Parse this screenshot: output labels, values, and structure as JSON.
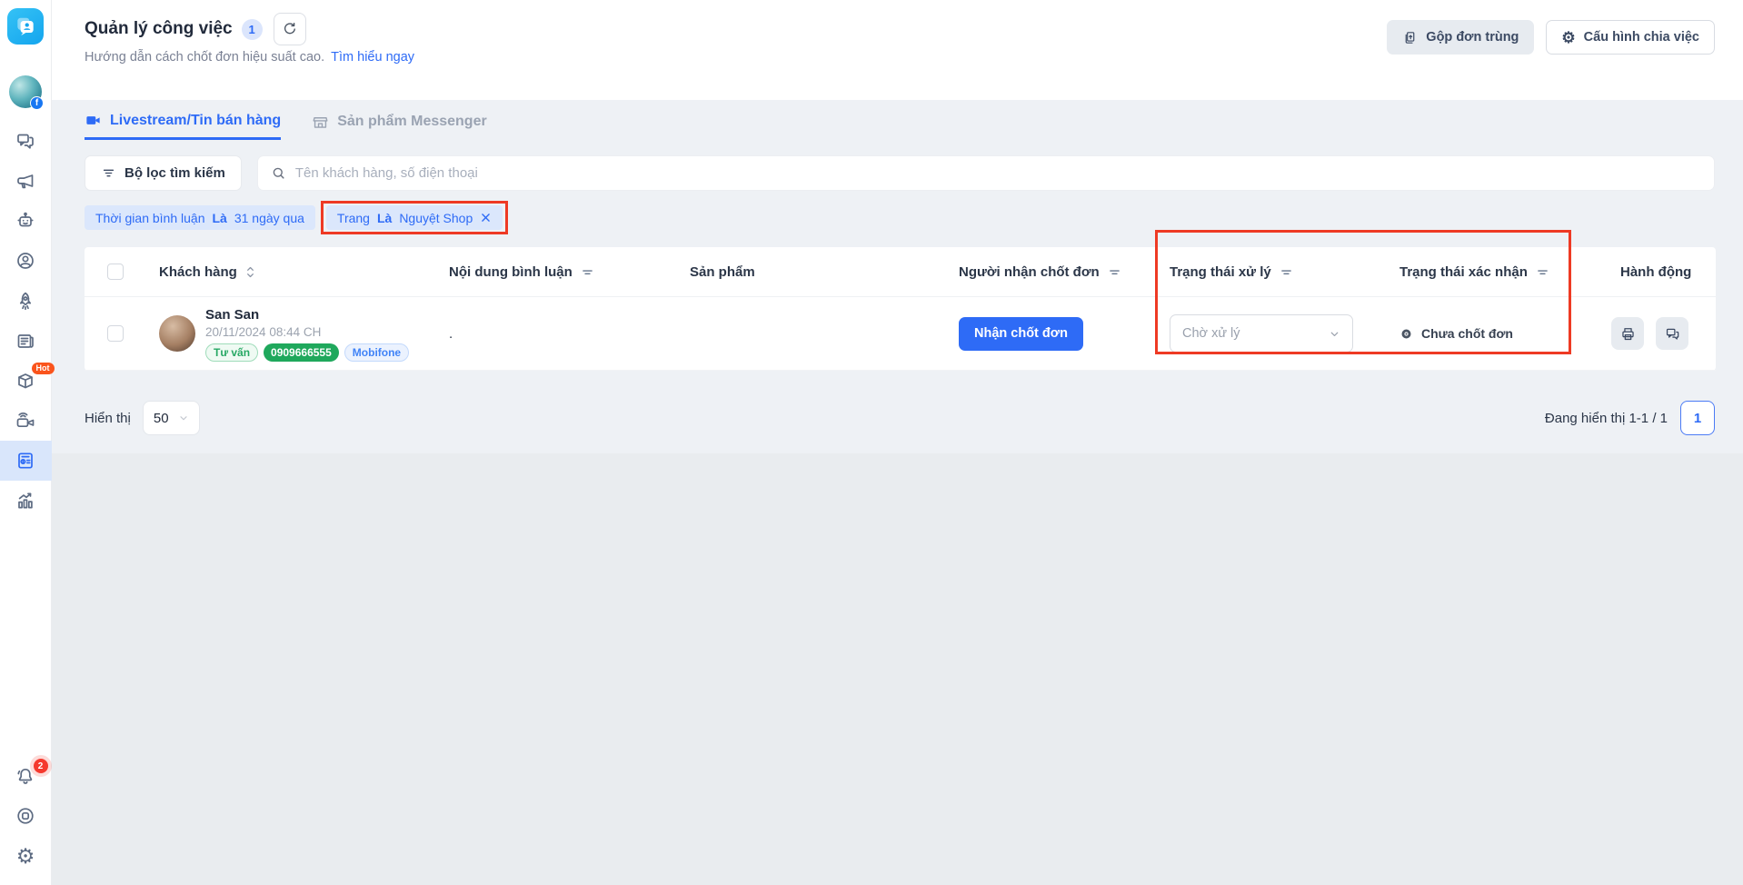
{
  "colors": {
    "accent": "#2e6bf6",
    "annotation_red": "#ee3a24",
    "green_solid": "#1fa85c",
    "sidebar_active_bg": "#d9e6fb"
  },
  "sidebar": {
    "hot_badge": "Hot",
    "notification_count": "2"
  },
  "header": {
    "title": "Quản lý công việc",
    "count_badge": "1",
    "subtitle": "Hướng dẫn cách chốt đơn hiệu suất cao.",
    "subtitle_link": "Tìm hiểu ngay",
    "merge_button": "Gộp đơn trùng",
    "config_button": "Cấu hình chia việc"
  },
  "tabs": {
    "livestream": "Livestream/Tin bán hàng",
    "messenger": "Sản phẩm Messenger"
  },
  "filter_bar": {
    "filter_button": "Bộ lọc tìm kiếm",
    "search_placeholder": "Tên khách hàng, số điện thoại"
  },
  "chips": {
    "time": {
      "prefix": "Thời gian bình luận",
      "operator": "Là",
      "value": "31 ngày qua"
    },
    "page": {
      "prefix": "Trang",
      "operator": "Là",
      "value": "Nguyệt Shop"
    }
  },
  "table": {
    "columns": [
      "Khách hàng",
      "Nội dung bình luận",
      "Sản phẩm",
      "Người nhận chốt đơn",
      "Trạng thái xử lý",
      "Trạng thái xác nhận",
      "Hành động"
    ],
    "row": {
      "name": "San San",
      "datetime": "20/11/2024 08:44 CH",
      "tag_consult": "Tư vấn",
      "tag_phone": "0909666555",
      "tag_carrier": "Mobifone",
      "comment": ".",
      "assign_button": "Nhận chốt đơn",
      "process_status": "Chờ xử lý",
      "confirm_status": "Chưa chốt đơn"
    }
  },
  "pagination": {
    "page_size_label": "Hiển thị",
    "page_size": "50",
    "range_text": "Đang hiển thị 1-1 / 1",
    "page": "1"
  }
}
